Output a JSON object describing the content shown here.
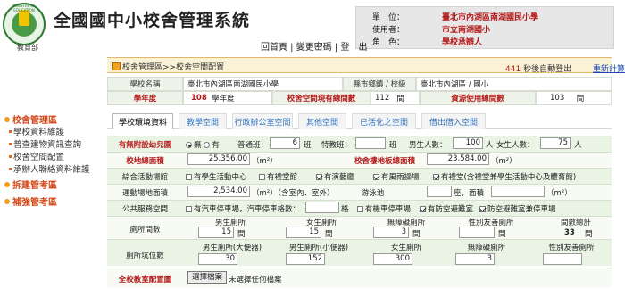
{
  "header": {
    "logo_text": "教育部",
    "logo_label": "MINISTRY OF EDUCATION",
    "title": "全國國中小校舍管理系統",
    "info": [
      {
        "k": "單　位：",
        "v": "臺北市內湖區南湖國民小學"
      },
      {
        "k": "使用者：",
        "v": "市立南湖國小"
      },
      {
        "k": "角　色：",
        "v": "學校承辦人"
      }
    ],
    "links": [
      "回首頁",
      "變更密碼",
      "登　出"
    ]
  },
  "breadcrumb": "校舍管理區>>校舍空間配置",
  "timer": {
    "count": "441",
    "text": "秒後自動登出",
    "relogin": "重新計算"
  },
  "sidebar": {
    "groups": [
      {
        "label": "校舍管理區",
        "items": [
          "學校資料維護",
          "普查建物資訊查詢",
          "校舍空間配置",
          "承辦人聯絡資料維護"
        ]
      },
      {
        "label": "拆建管考區",
        "items": []
      },
      {
        "label": "補強管考區",
        "items": []
      }
    ]
  },
  "school_info": {
    "name_label": "學校名稱",
    "name_value": "臺北市內湖區南湖國民小學",
    "county_label": "縣市鄉鎮 / 校級",
    "county_value": "臺北市內湖區 / 國小",
    "year_label": "學年度",
    "year_value": "108",
    "year_unit": "學年度",
    "space_label": "校舍空間現有總間數",
    "space_value": "112",
    "space_unit": "間",
    "used_label": "資源使用總間數",
    "used_value": "103",
    "used_unit": "間"
  },
  "tabs": [
    "學校環境資料",
    "教學空間",
    "行政辦公室空間",
    "其他空間",
    "已活化之空間",
    "借出借入空間"
  ],
  "env": {
    "kinder_label": "有無附設幼兒園",
    "kinder_opts": [
      "無",
      "有"
    ],
    "normal_class_label": "普通班：",
    "normal_class_value": "6",
    "class_unit": "班",
    "special_class_label": "特教班：",
    "special_class_value": "",
    "male_label": "男生人數：",
    "male_value": "100",
    "person_unit": "人",
    "female_label": "女生人數：",
    "female_value": "75",
    "land_label": "校地總面積",
    "land_value": "25,356.00",
    "area_unit": "（m²）",
    "floor_label": "校舍樓地板總面積",
    "floor_value": "23,584.00",
    "activity_label": "綜合活動場館",
    "activity_opts": [
      {
        "label": "有學生活動中心",
        "on": false
      },
      {
        "label": "有禮堂館",
        "on": false
      },
      {
        "label": "有演藝廳",
        "on": true
      },
      {
        "label": "有風雨操場",
        "on": true
      },
      {
        "label": "有禮堂(含禮堂兼學生活動中心及體育館)",
        "on": true
      }
    ],
    "sport_label": "運動場地面積",
    "sport_value": "2,534.00",
    "sport_unit": "（m²）（含室內、室外）",
    "pool_label": "游泳池",
    "pool_value": "",
    "pool_unit": "座，面積",
    "pool_area_unit": "（m²）",
    "public_label": "公共服務空間",
    "public_opts": [
      {
        "label": "有汽車停車場，汽車停車格數：",
        "on": false
      },
      {
        "label": "有機車停車場",
        "on": false
      },
      {
        "label": "有防空避難室",
        "on": true
      },
      {
        "label": "防空避難室兼停車場",
        "on": true
      }
    ],
    "public_unit": "格",
    "toilet_label": "廁所間數",
    "toilet_headers": [
      "男生廁所",
      "女生廁所",
      "無障礙廁所",
      "性別友善廁所",
      "間數總計"
    ],
    "toilet_values": [
      "15",
      "15",
      "3",
      "",
      "33"
    ],
    "toilet_unit": "間",
    "stall_label": "廁所坑位數",
    "stall_headers": [
      "男生廁所(大便器)",
      "男生廁所(小便器)",
      "女生廁所",
      "無障礙廁所",
      "性別友善廁所"
    ],
    "stall_values": [
      "30",
      "152",
      "300",
      "3",
      ""
    ],
    "plan_label": "全校教室配置圖",
    "plan_button": "選擇檔案",
    "plan_status": "未選擇任何檔案"
  }
}
